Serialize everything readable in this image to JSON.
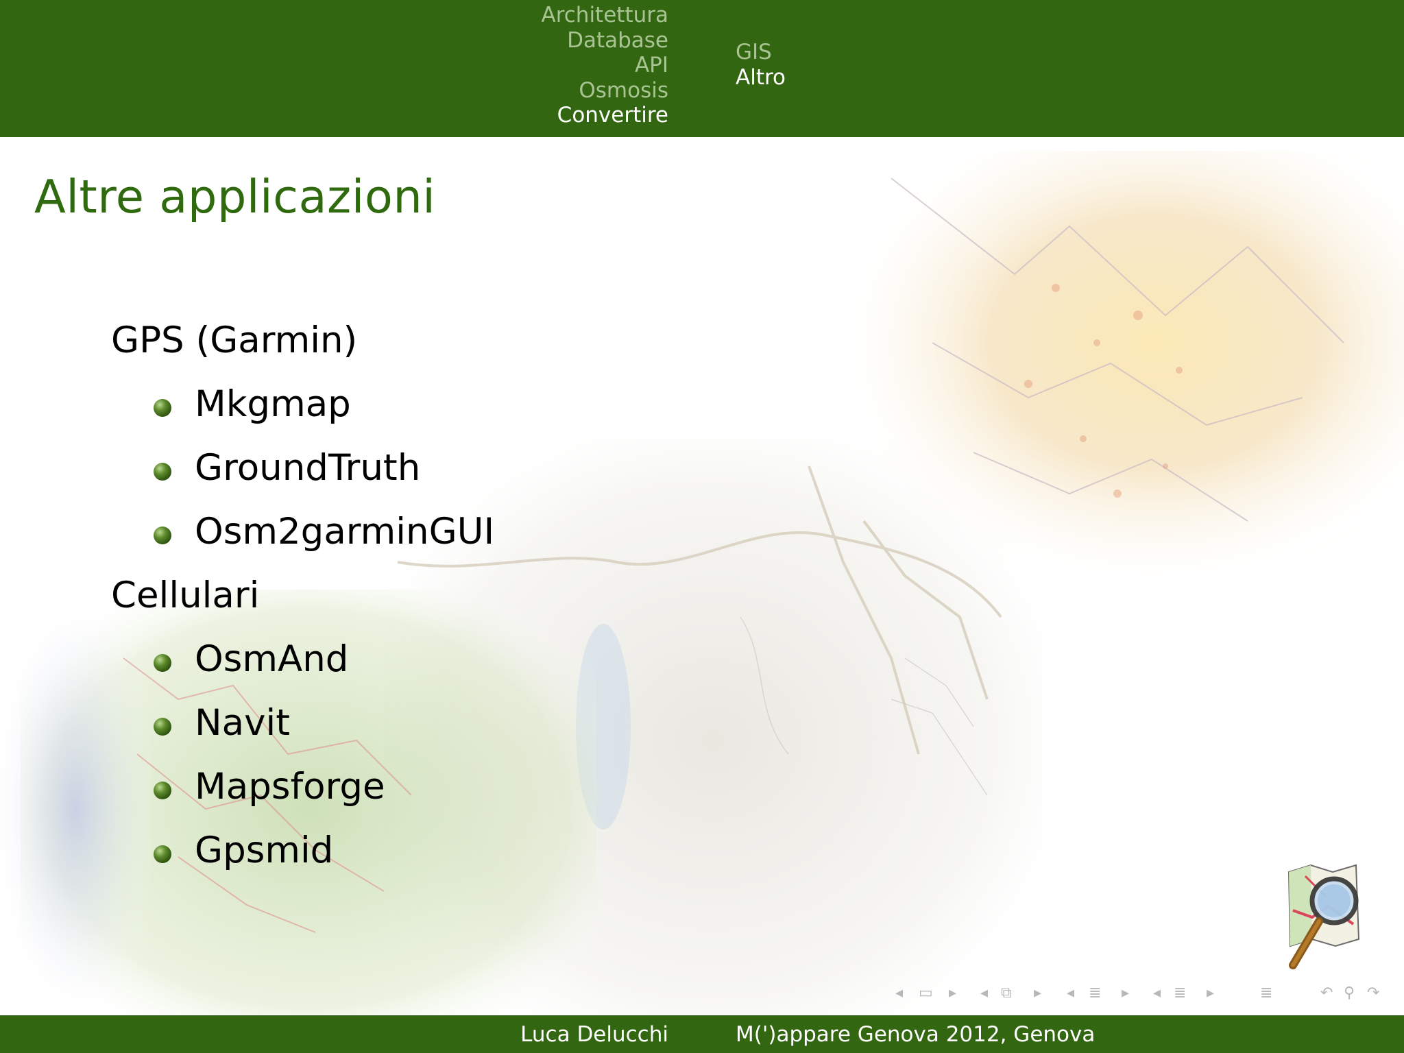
{
  "header": {
    "sections_left": [
      {
        "label": "Architettura",
        "active": false
      },
      {
        "label": "Database",
        "active": false
      },
      {
        "label": "API",
        "active": false
      },
      {
        "label": "Osmosis",
        "active": false
      },
      {
        "label": "Convertire",
        "active": true
      }
    ],
    "sections_right": [
      {
        "label": "GIS",
        "active": false
      },
      {
        "label": "Altro",
        "active": true
      }
    ]
  },
  "slide": {
    "title": "Altre applicazioni",
    "groups": [
      {
        "heading": "GPS (Garmin)",
        "items": [
          "Mkgmap",
          "GroundTruth",
          "Osm2garminGUI"
        ]
      },
      {
        "heading": "Cellulari",
        "items": [
          "OsmAnd",
          "Navit",
          "Mapsforge",
          "Gpsmid"
        ]
      }
    ]
  },
  "footer": {
    "author": "Luca Delucchi",
    "event": "M(')appare Genova 2012, Genova"
  },
  "nav_controls": [
    "first-frame-icon",
    "frame-icon",
    "next-frame-icon",
    "prev-subsection-icon",
    "subsection-icon",
    "next-subsection-icon",
    "prev-section-icon",
    "section-icon",
    "next-section-icon",
    "prev-toc-icon",
    "toc-icon",
    "next-toc-icon",
    "document-icon",
    "back-icon",
    "search-icon",
    "forward-icon"
  ],
  "colors": {
    "bar": "#336611",
    "title": "#2f6b0e",
    "nav_inactive": "#a8c493",
    "nav_active": "#ffffff"
  }
}
